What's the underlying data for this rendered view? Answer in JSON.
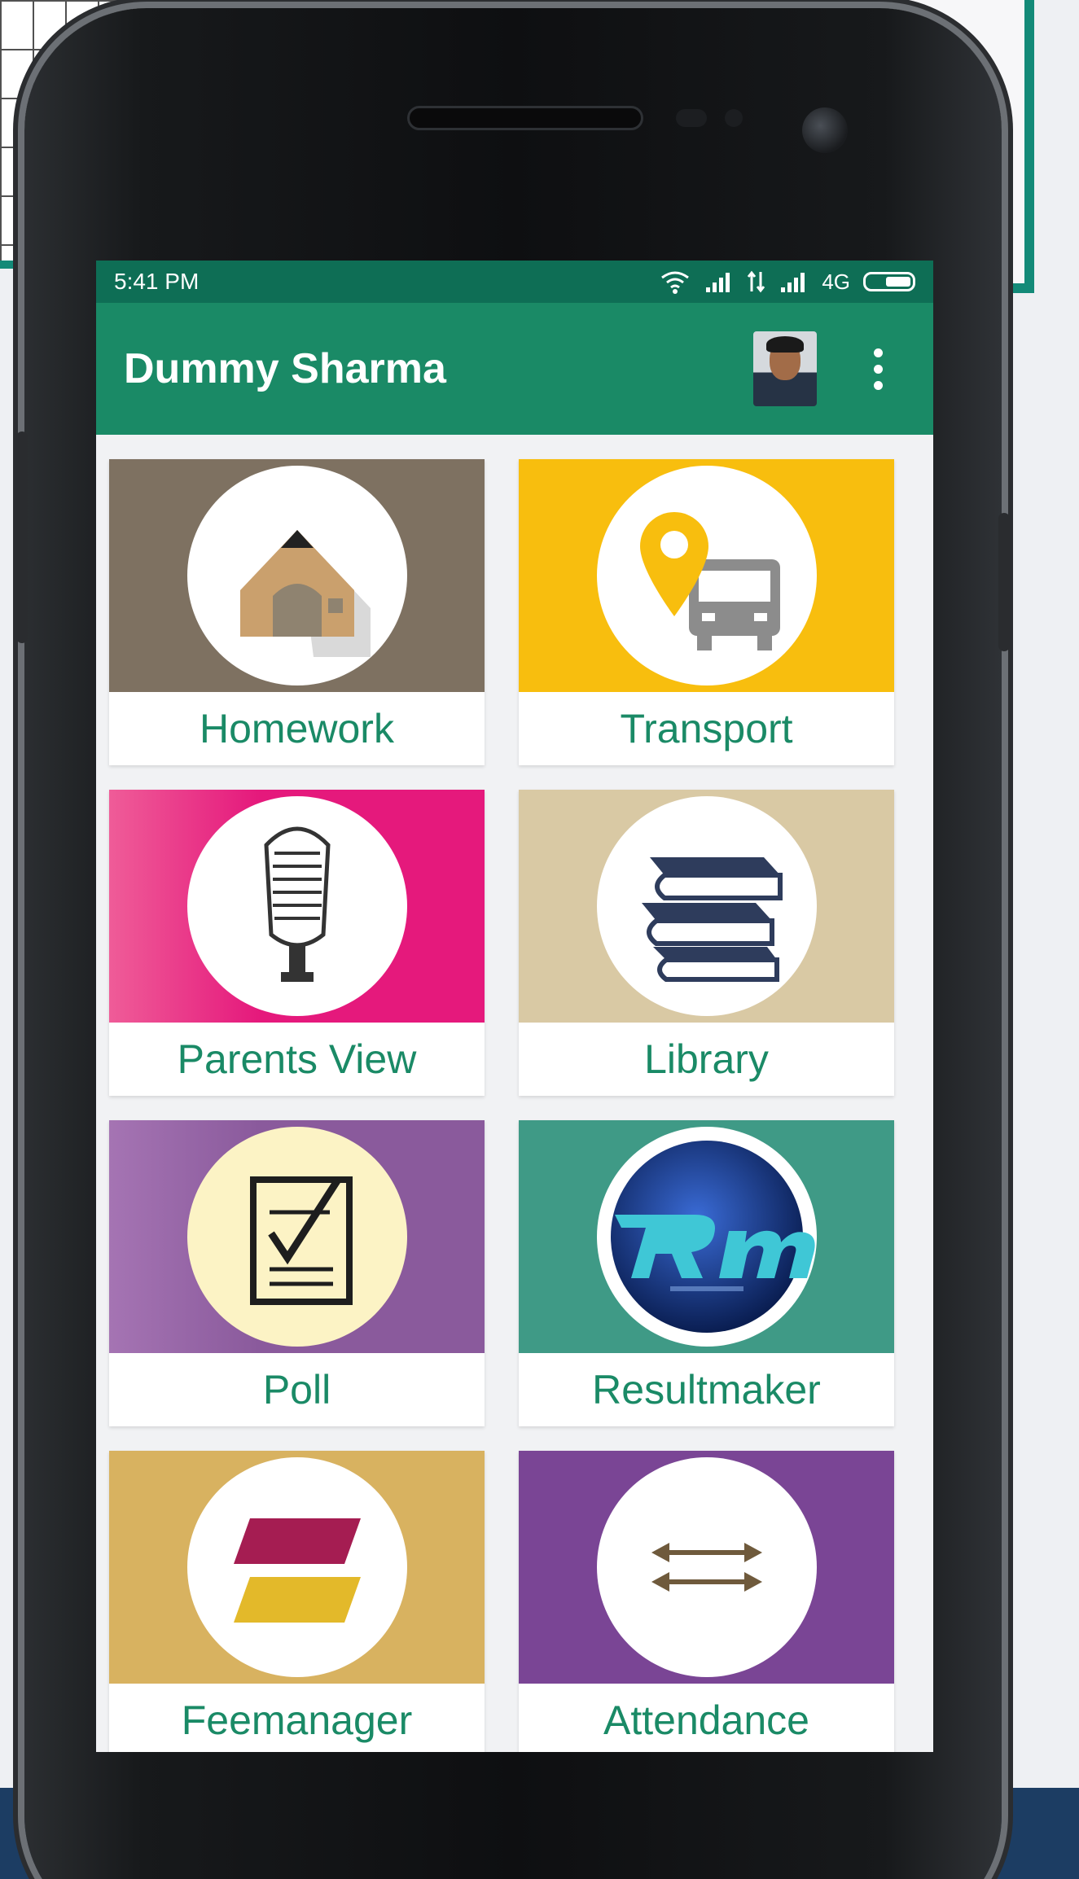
{
  "status_bar": {
    "time": "5:41 PM",
    "network": "4G"
  },
  "app_bar": {
    "title": "Dummy Sharma"
  },
  "tiles": [
    {
      "label": "Homework",
      "icon": "house-icon",
      "color": "#7e7161"
    },
    {
      "label": "Transport",
      "icon": "bus-location-icon",
      "color": "#f8be0e"
    },
    {
      "label": "Parents View",
      "icon": "microphone-icon",
      "color": "#e5197c"
    },
    {
      "label": "Library",
      "icon": "books-icon",
      "color": "#d9c9a4"
    },
    {
      "label": "Poll",
      "icon": "ballot-checkmark-icon",
      "color": "#8a5a9c"
    },
    {
      "label": "Resultmaker",
      "icon": "resultmaker-logo",
      "color": "#3f9a86"
    },
    {
      "label": "Feemanager",
      "icon": "feemanager-logo",
      "color": "#d8b260"
    },
    {
      "label": "Attendance",
      "icon": "arrows-icon",
      "color": "#7a4595"
    }
  ],
  "colors": {
    "status_bar": "#0e6e55",
    "app_bar": "#1a8a66",
    "label_text": "#1a8a66"
  }
}
